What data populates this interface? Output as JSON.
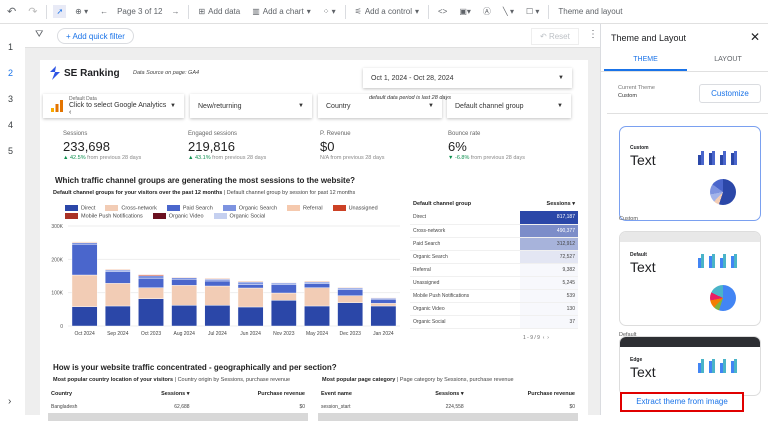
{
  "toolbar": {
    "undo": "↶",
    "redo": "↷",
    "page": "Page 3 of 12",
    "add_data": "Add data",
    "add_chart": "Add a chart",
    "add_control": "Add a control",
    "theme_layout": "Theme and layout"
  },
  "filterbar": {
    "quick_filter": "+ Add quick filter",
    "reset": "Reset"
  },
  "gutter": {
    "pages": [
      "1",
      "2",
      "3",
      "4",
      "5"
    ],
    "active": "2"
  },
  "report": {
    "brand": "SE Ranking",
    "data_source": "Data Source on page: GA4",
    "date_range": "Oct 1, 2024 - Oct 28, 2024",
    "date_note": "default data period is last 28 days",
    "controls": {
      "ga_label": "Default Data",
      "ga_value": "Click to select Google Analytics ‹",
      "new_returning": "New/returning",
      "country": "Country",
      "channel_group": "Default channel group"
    },
    "kpis": [
      {
        "label": "Sessions",
        "value": "233,698",
        "change": "42.5%",
        "suffix": " from previous 28 days",
        "dir": "up"
      },
      {
        "label": "Engaged sessions",
        "value": "219,816",
        "change": "43.1%",
        "suffix": " from previous 28 days",
        "dir": "up"
      },
      {
        "label": "P. Revenue",
        "value": "$0",
        "change": "N/A",
        "suffix": " from previous 28 days",
        "dir": "none"
      },
      {
        "label": "Bounce rate",
        "value": "6%",
        "change": "-6.8%",
        "suffix": " from previous 28 days",
        "dir": "down"
      }
    ],
    "section1_title": "Which traffic channel groups are generating the most sessions to the website?",
    "section1_sub_bold": "Default channel groups for your visitors over the past 12 months",
    "section1_sub": " | Default channel group by session for past 12 months",
    "channel_table": {
      "headers": [
        "Default channel group",
        "Sessions ▾"
      ],
      "rows": [
        [
          "Direct",
          "817,187"
        ],
        [
          "Cross-network",
          "490,377"
        ],
        [
          "Paid Search",
          "312,912"
        ],
        [
          "Organic Search",
          "72,527"
        ],
        [
          "Referral",
          "9,382"
        ],
        [
          "Unassigned",
          "5,245"
        ],
        [
          "Mobile Push Notifications",
          "539"
        ],
        [
          "Organic Video",
          "130"
        ],
        [
          "Organic Social",
          "37"
        ]
      ],
      "pagination": "1 - 9 / 9"
    },
    "section2_title": "How is your website traffic concentrated - geographically and per section?",
    "country_sub_bold": "Most popular country location of your visitors",
    "country_sub": " | Country origin by Sessions, purchase revenue",
    "country_table": {
      "headers": [
        "Country",
        "Sessions ▾",
        "Purchase revenue"
      ],
      "rows": [
        [
          "Bangladesh",
          "62,688",
          "$0"
        ]
      ]
    },
    "page_sub_bold": "Most popular page category",
    "page_sub": " | Page category by Sessions, purchase revenue",
    "page_table": {
      "headers": [
        "Event name",
        "Sessions ▾",
        "Purchase revenue"
      ],
      "rows": [
        [
          "session_start",
          "224,558",
          "$0"
        ]
      ]
    }
  },
  "chart_data": {
    "type": "bar",
    "stacked": true,
    "categories": [
      "Oct 2024",
      "Sep 2024",
      "Oct 2023",
      "Aug 2024",
      "Jul 2024",
      "Jun 2024",
      "Nov 2023",
      "May 2024",
      "Dec 2023",
      "Jan 2024"
    ],
    "yticks": [
      "0",
      "100K",
      "200K",
      "300K"
    ],
    "ylim": [
      0,
      300000
    ],
    "grid": true,
    "legend": "top",
    "series": [
      {
        "name": "Direct",
        "color": "#2b47a8",
        "values": [
          58000,
          60000,
          82000,
          62000,
          62000,
          57000,
          77000,
          60000,
          70000,
          60000
        ]
      },
      {
        "name": "Cross-network",
        "color": "#f2ccb5",
        "values": [
          95000,
          68000,
          33000,
          60000,
          58000,
          57000,
          22000,
          55000,
          21000,
          8000
        ]
      },
      {
        "name": "Paid Search",
        "color": "#4a66cc",
        "values": [
          92000,
          35000,
          28000,
          18000,
          15000,
          10000,
          25000,
          12000,
          18000,
          12000
        ]
      },
      {
        "name": "Organic Search",
        "color": "#7d93e0",
        "values": [
          5000,
          5000,
          8000,
          5000,
          5000,
          8000,
          5000,
          5000,
          5000,
          3000
        ]
      },
      {
        "name": "Referral",
        "color": "#f5c9ae",
        "values": [
          3000,
          3000,
          0,
          2000,
          3000,
          3000,
          1000,
          3000,
          2000,
          2000
        ]
      },
      {
        "name": "Unassigned",
        "color": "#cc4125",
        "values": [
          0,
          1000,
          3000,
          0,
          0,
          0,
          0,
          0,
          0,
          0
        ]
      },
      {
        "name": "Mobile Push Notifications",
        "color": "#a93226",
        "values": [
          0,
          0,
          0,
          0,
          0,
          0,
          1000,
          0,
          0,
          0
        ]
      },
      {
        "name": "Organic Video",
        "color": "#6b1020",
        "values": [
          0,
          0,
          0,
          0,
          0,
          0,
          1000,
          0,
          0,
          0
        ]
      },
      {
        "name": "Organic Social",
        "color": "#c5d0f0",
        "values": [
          0,
          0,
          0,
          0,
          0,
          0,
          0,
          0,
          0,
          0
        ]
      }
    ]
  },
  "panel": {
    "title": "Theme and Layout",
    "tabs": [
      "THEME",
      "LAYOUT"
    ],
    "current_label": "Current Theme",
    "current_value": "Custom",
    "customize": "Customize",
    "themes": [
      {
        "name": "Custom",
        "caption": "Custom",
        "sample": "Text"
      },
      {
        "name": "Default",
        "caption": "Default",
        "sample": "Text"
      },
      {
        "name": "Edge",
        "caption": "",
        "sample": "Text"
      }
    ],
    "extract": "Extract theme from image",
    "accent": "#1a73e8",
    "highlight": "#e00000"
  }
}
